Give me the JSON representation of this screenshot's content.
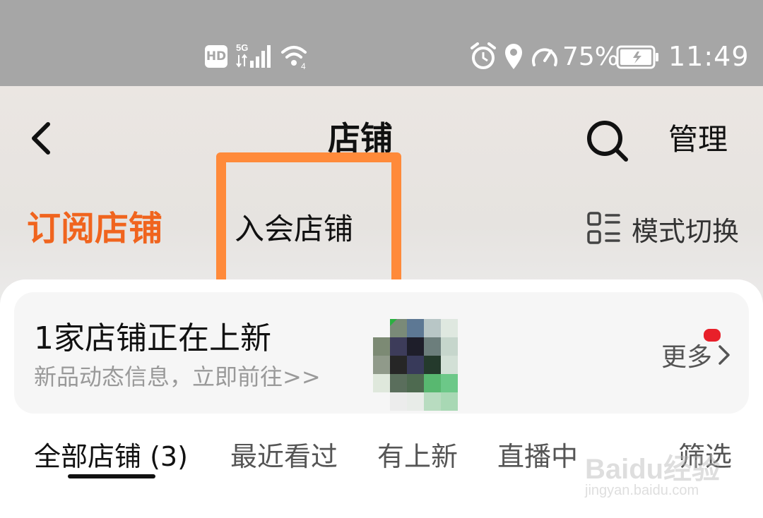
{
  "status_bar": {
    "hd": "HD",
    "network": "5G",
    "battery_percent": "75%",
    "time": "11:49",
    "icons": [
      "hd-icon",
      "signal-icon",
      "wifi-icon",
      "alarm-icon",
      "location-icon",
      "speed-icon",
      "battery-icon"
    ]
  },
  "header": {
    "title": "店铺",
    "manage_label": "管理",
    "back_icon": "chevron-left-icon",
    "search_icon": "search-icon"
  },
  "tabs": {
    "subscribed": "订阅店铺",
    "member": "入会店铺",
    "mode_switch": "模式切换"
  },
  "banner": {
    "title": "1家店铺正在上新",
    "subtitle": "新品动态信息，立即前往>>",
    "more_label": "更多"
  },
  "filter_tabs": [
    {
      "label": "全部店铺 (3)",
      "active": true
    },
    {
      "label": "最近看过",
      "active": false
    },
    {
      "label": "有上新",
      "active": false
    },
    {
      "label": "直播中",
      "active": false
    },
    {
      "label": "筛选",
      "active": false
    }
  ],
  "watermark": {
    "text": "Baidu经验",
    "url": "jingyan.baidu.com"
  },
  "colors": {
    "accent": "#f0641e",
    "highlight": "#ff8a3a",
    "status_bar": "#a6a6a6",
    "red_dot": "#e8202a"
  }
}
